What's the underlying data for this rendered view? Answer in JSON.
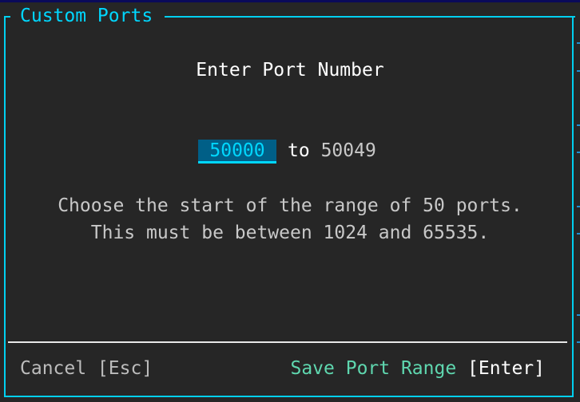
{
  "dialog": {
    "title": "Custom Ports",
    "heading": "Enter Port Number",
    "start_port": "50000",
    "to_label": "to",
    "end_port": "50049",
    "description_line1": "Choose the start of the range of 50 ports.",
    "description_line2": "This must be between 1024 and 65535.",
    "cancel_label": "Cancel [Esc]",
    "save_label": "Save Port Range",
    "save_key": "[Enter]"
  },
  "colors": {
    "accent": "#00d7ff",
    "save": "#5fd7af",
    "background": "#262626",
    "input_bg": "#005f87"
  }
}
